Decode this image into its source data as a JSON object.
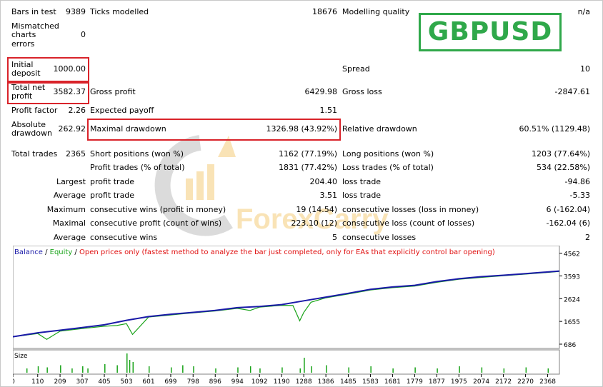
{
  "brand": {
    "symbol": "GBPUSD",
    "watermark": "ForexCarry"
  },
  "stats": {
    "bars_label": "Bars in test",
    "bars_value": "9389",
    "ticks_label": "Ticks modelled",
    "ticks_value": "18676",
    "quality_label": "Modelling quality",
    "quality_value": "n/a",
    "mismatch_label_1": "Mismatched",
    "mismatch_label_2": "charts",
    "mismatch_label_3": "errors",
    "mismatch_value": "0",
    "deposit_label_1": "Initial",
    "deposit_label_2": "deposit",
    "deposit_value": "1000.00",
    "spread_label": "Spread",
    "spread_value": "10",
    "net_label_1": "Total net",
    "net_label_2": "profit",
    "net_value": "3582.37",
    "gross_profit_label": "Gross profit",
    "gross_profit_value": "6429.98",
    "gross_loss_label": "Gross loss",
    "gross_loss_value": "-2847.61",
    "pf_label": "Profit factor",
    "pf_value": "2.26",
    "ep_label": "Expected payoff",
    "ep_value": "1.51",
    "abs_dd_label_1": "Absolute",
    "abs_dd_label_2": "drawdown",
    "abs_dd_value": "262.92",
    "max_dd_label": "Maximal drawdown",
    "max_dd_value": "1326.98 (43.92%)",
    "rel_dd_label": "Relative drawdown",
    "rel_dd_value": "60.51% (1129.48)",
    "trades_label": "Total trades",
    "trades_value": "2365",
    "short_label": "Short positions (won %)",
    "short_value": "1162 (77.19%)",
    "long_label": "Long positions (won %)",
    "long_value": "1203 (77.64%)",
    "pt_label": "Profit trades (% of total)",
    "pt_value": "1831 (77.42%)",
    "lt_label": "Loss trades (% of total)",
    "lt_value": "534 (22.58%)",
    "largest_label": "Largest",
    "largest_pt_label": "profit trade",
    "largest_pt_value": "204.40",
    "largest_lt_label": "loss trade",
    "largest_lt_value": "-94.86",
    "average_label": "Average",
    "average_pt_label": "profit trade",
    "average_pt_value": "3.51",
    "average_lt_label": "loss trade",
    "average_lt_value": "-5.33",
    "maximum_label": "Maximum",
    "max_cw_label": "consecutive wins (profit in money)",
    "max_cw_value": "19 (14.54)",
    "max_cl_label": "consecutive losses (loss in money)",
    "max_cl_value": "6 (-162.04)",
    "maximal_label": "Maximal",
    "maximal_cp_label": "consecutive profit (count of wins)",
    "maximal_cp_value": "223.10 (12)",
    "maximal_cl_label": "consecutive loss (count of losses)",
    "maximal_cl_value": "-162.04 (6)",
    "avg2_label": "Average",
    "avg_cw_label": "consecutive wins",
    "avg_cw_value": "5",
    "avg_cl_label": "consecutive losses",
    "avg_cl_value": "2"
  },
  "legend": {
    "balance": "Balance",
    "sep1": " / ",
    "equity": "Equity",
    "sep2": " / ",
    "note": "Open prices only (fastest method to analyze the bar just completed, only for EAs that explicitly control bar opening)"
  },
  "colors": {
    "balance": "#1a1aa8",
    "equity": "#19a319",
    "note": "#e01010",
    "highlight": "#d9232a",
    "brand": "#2fa84a"
  },
  "chart_data": {
    "type": "line",
    "series": [
      {
        "name": "Balance",
        "x": [
          0,
          110,
          209,
          307,
          405,
          503,
          601,
          699,
          798,
          896,
          994,
          1092,
          1190,
          1288,
          1386,
          1485,
          1583,
          1681,
          1779,
          1877,
          1975,
          2074,
          2172,
          2270,
          2368,
          2420
        ],
        "values": [
          1000,
          1170,
          1280,
          1390,
          1510,
          1700,
          1860,
          1960,
          2040,
          2120,
          2240,
          2290,
          2370,
          2530,
          2690,
          2850,
          3020,
          3120,
          3190,
          3350,
          3470,
          3560,
          3620,
          3690,
          3760,
          3800
        ]
      },
      {
        "name": "Equity",
        "x": [
          0,
          110,
          150,
          209,
          307,
          405,
          460,
          503,
          530,
          601,
          699,
          798,
          896,
          994,
          1050,
          1092,
          1190,
          1240,
          1270,
          1288,
          1320,
          1386,
          1485,
          1583,
          1681,
          1779,
          1877,
          1975,
          2074,
          2172,
          2270,
          2368,
          2420
        ],
        "values": [
          1000,
          1140,
          890,
          1240,
          1350,
          1450,
          1480,
          1560,
          1100,
          1840,
          1930,
          2020,
          2100,
          2210,
          2120,
          2260,
          2340,
          2330,
          1680,
          2040,
          2470,
          2660,
          2820,
          2990,
          3090,
          3160,
          3320,
          3450,
          3530,
          3600,
          3670,
          3740,
          3780
        ]
      }
    ],
    "xlim": [
      0,
      2420
    ],
    "ylim": [
      686,
      4760
    ],
    "x_ticks": [
      0,
      110,
      209,
      307,
      405,
      503,
      601,
      699,
      798,
      896,
      994,
      1092,
      1190,
      1288,
      1386,
      1485,
      1583,
      1681,
      1779,
      1877,
      1975,
      2074,
      2172,
      2270,
      2368
    ],
    "y_ticks": [
      4562,
      3593,
      2624,
      1655,
      686
    ],
    "size_label": "Size",
    "size_bars": {
      "x": [
        60,
        110,
        150,
        209,
        260,
        307,
        330,
        405,
        460,
        503,
        515,
        530,
        601,
        699,
        750,
        798,
        896,
        994,
        1050,
        1092,
        1190,
        1270,
        1288,
        1320,
        1386,
        1485,
        1583,
        1681,
        1779,
        1877,
        1975,
        2074,
        2172,
        2270,
        2368
      ],
      "values": [
        0.2,
        0.3,
        0.25,
        0.35,
        0.2,
        0.3,
        0.2,
        0.4,
        0.35,
        0.9,
        0.6,
        0.5,
        0.3,
        0.25,
        0.35,
        0.3,
        0.2,
        0.25,
        0.3,
        0.2,
        0.25,
        0.2,
        0.7,
        0.3,
        0.35,
        0.25,
        0.3,
        0.2,
        0.25,
        0.2,
        0.3,
        0.25,
        0.2,
        0.25,
        0.2
      ]
    },
    "grid": false
  }
}
